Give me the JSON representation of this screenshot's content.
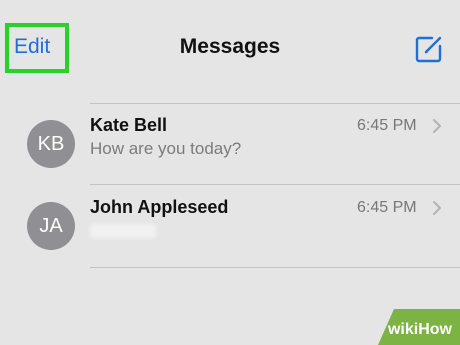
{
  "header": {
    "edit_label": "Edit",
    "title": "Messages",
    "compose_icon": "compose-icon"
  },
  "conversations": [
    {
      "initials": "KB",
      "name": "Kate Bell",
      "time": "6:45 PM",
      "preview": "How are you today?"
    },
    {
      "initials": "JA",
      "name": "John Appleseed",
      "time": "6:45 PM",
      "preview": ""
    }
  ],
  "watermark": {
    "text": "wikiHow"
  },
  "colors": {
    "accent": "#1f6fd9",
    "highlight": "#29d12a",
    "avatar": "#8f8f94",
    "background": "#e5e5e5"
  }
}
